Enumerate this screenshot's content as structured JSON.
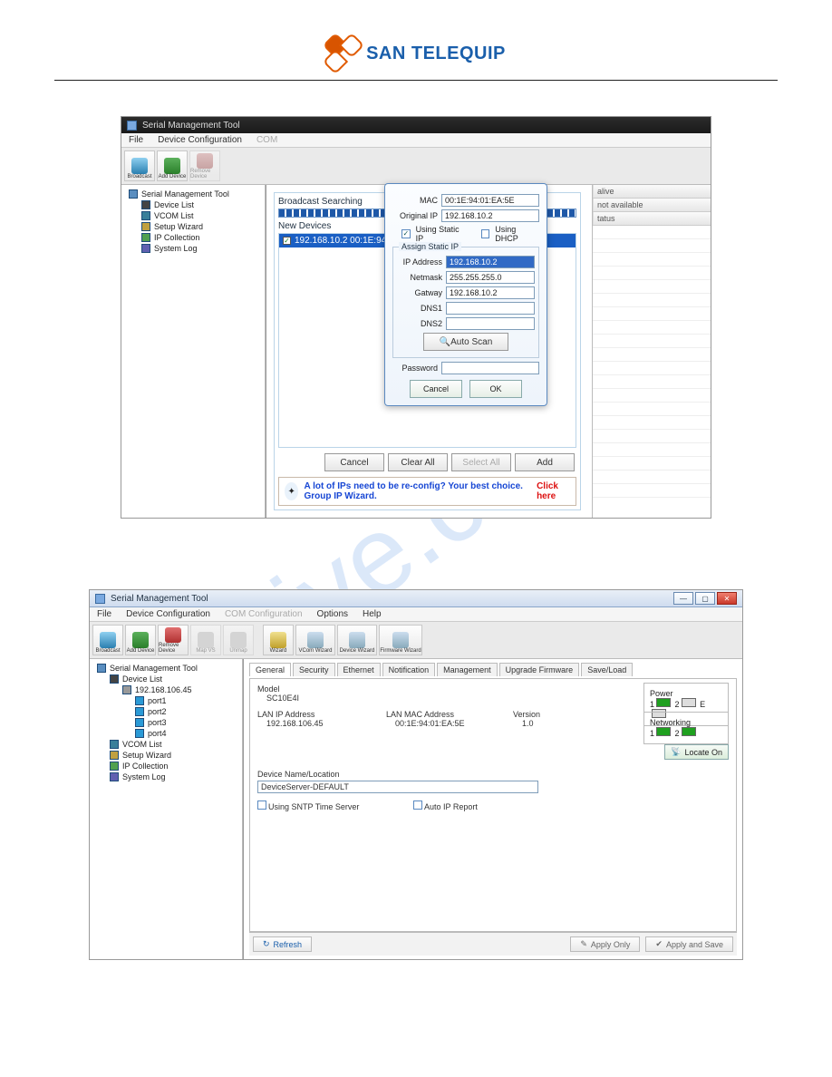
{
  "brand": {
    "name": "SAN TELEQUIP"
  },
  "shot1": {
    "window_title": "Serial Management Tool",
    "menu": {
      "file": "File",
      "devconf": "Device Configuration",
      "comconf": "COM"
    },
    "toolbar": {
      "broadcast": "Broadcast",
      "adddev": "Add Device",
      "remdev": "Remove Device"
    },
    "tree": {
      "root": "Serial Management Tool",
      "devlist": "Device List",
      "vcomlist": "VCOM List",
      "setupwiz": "Setup Wizard",
      "ipcoll": "IP Collection",
      "syslog": "System Log"
    },
    "search": {
      "title": "Broadcast Searching",
      "newdev": "New Devices",
      "device_entry": "192.168.10.2  00:1E:94:01:EA:5E"
    },
    "buttons": {
      "cancel": "Cancel",
      "clearall": "Clear All",
      "selectall": "Select All",
      "add": "Add"
    },
    "promo": {
      "text": "A lot of IPs need to be re-config? Your best choice. Group IP Wizard.",
      "click": "Click here"
    },
    "dialog": {
      "mac_lbl": "MAC",
      "mac_val": "00:1E:94:01:EA:5E",
      "origip_lbl": "Original IP",
      "origip_val": "192.168.10.2",
      "static_chk": "Using Static IP",
      "dhcp_chk": "Using DHCP",
      "assign_legend": "Assign Static IP",
      "ip_lbl": "IP Address",
      "ip_val": "192.168.10.2",
      "nm_lbl": "Netmask",
      "nm_val": "255.255.255.0",
      "gw_lbl": "Gatway",
      "gw_val": "192.168.10.2",
      "dns1_lbl": "DNS1",
      "dns1_val": "",
      "dns2_lbl": "DNS2",
      "dns2_val": "",
      "autoscan": "Auto Scan",
      "pwd_lbl": "Password",
      "pwd_val": "",
      "cancel": "Cancel",
      "ok": "OK"
    },
    "rightgrid": {
      "col_alive": "alive",
      "col_na": "not available",
      "col_status": "tatus"
    }
  },
  "shot2": {
    "window_title": "Serial Management Tool",
    "menu": {
      "file": "File",
      "devconf": "Device Configuration",
      "comconf": "COM Configuration",
      "options": "Options",
      "help": "Help"
    },
    "toolbar": {
      "broadcast": "Broadcast",
      "adddev": "Add Device",
      "remdev": "Remove Device",
      "mapvs": "Map VS",
      "unmap": "Unmap",
      "wizard": "Wizard",
      "vcomwiz": "VCom Wizard",
      "devwiz": "Device Wizard",
      "fwwiz": "Firmware Wizard"
    },
    "tree": {
      "root": "Serial Management Tool",
      "devlist": "Device List",
      "ip": "192.168.106.45",
      "p1": "port1",
      "p2": "port2",
      "p3": "port3",
      "p4": "port4",
      "vcomlist": "VCOM List",
      "setupwiz": "Setup Wizard",
      "ipcoll": "IP Collection",
      "syslog": "System Log"
    },
    "tabs": {
      "general": "General",
      "security": "Security",
      "ethernet": "Ethernet",
      "notification": "Notification",
      "management": "Management",
      "upgrade": "Upgrade Firmware",
      "saveload": "Save/Load"
    },
    "general": {
      "model_lbl": "Model",
      "model_val": "SC10E4I",
      "lanip_lbl": "LAN IP Address",
      "lanip_val": "192.168.106.45",
      "lanmac_lbl": "LAN MAC Address",
      "lanmac_val": "00:1E:94:01:EA:5E",
      "ver_lbl": "Version",
      "ver_val": "1.0",
      "power_lbl": "Power",
      "p1": "1",
      "p2": "2",
      "pe": "E",
      "net_lbl": "Networking",
      "n1": "1",
      "n2": "2",
      "locate": "Locate On",
      "devloc_lbl": "Device Name/Location",
      "devloc_val": "DeviceServer-DEFAULT",
      "sntp_chk": "Using SNTP Time Server",
      "autoip_chk": "Auto IP Report"
    },
    "footer": {
      "refresh": "Refresh",
      "applyonly": "Apply Only",
      "applysave": "Apply and Save"
    }
  }
}
